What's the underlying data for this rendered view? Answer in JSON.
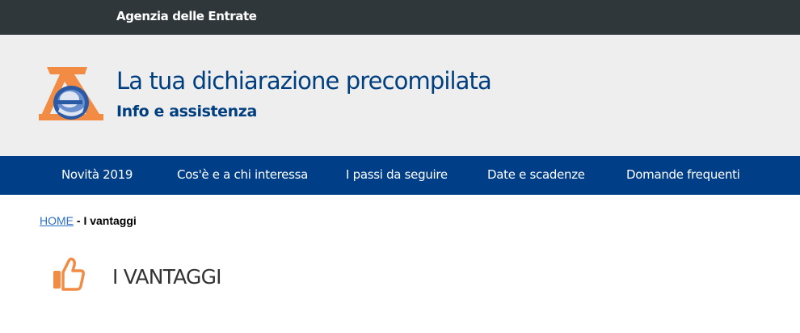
{
  "topbar": {
    "agency_link": "Agenzia delle Entrate"
  },
  "header": {
    "logo_icon": "agenzia-entrate-logo-icon",
    "title": "La tua dichiarazione precompilata",
    "subtitle": "Info e assistenza"
  },
  "nav": {
    "items": [
      {
        "label": "Novità 2019"
      },
      {
        "label": "Cos'è e a chi interessa"
      },
      {
        "label": "I passi da seguire"
      },
      {
        "label": "Date e scadenze"
      },
      {
        "label": "Domande frequenti"
      }
    ]
  },
  "breadcrumb": {
    "home": "HOME",
    "separator": " - ",
    "current": "I vantaggi"
  },
  "page": {
    "icon": "thumbs-up-icon",
    "title": "I VANTAGGI"
  },
  "colors": {
    "topbar": "#30373b",
    "header_bg": "#eeeeef",
    "brand_blue": "#003f88",
    "accent_orange": "#f28c45"
  }
}
